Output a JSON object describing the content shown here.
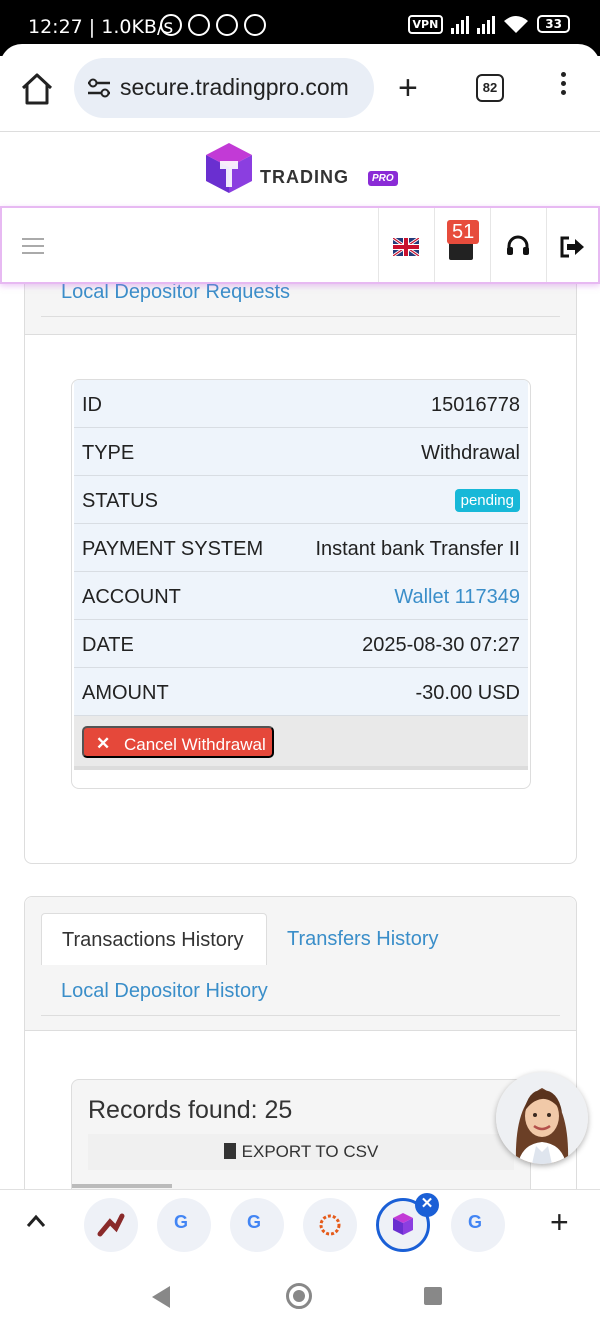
{
  "status_bar": {
    "time": "12:27 | 1.0KB/s",
    "vpn": "VPN",
    "battery": "33"
  },
  "browser": {
    "url": "secure.tradingpro.com",
    "tab_count": "82"
  },
  "brand": {
    "name": "TRADING",
    "tag": "PRO"
  },
  "navbar": {
    "messages_badge": "51"
  },
  "request_panel": {
    "header_link": "Local Depositor Requests",
    "rows": [
      {
        "key": "ID",
        "value": "15016778"
      },
      {
        "key": "TYPE",
        "value": "Withdrawal"
      },
      {
        "key": "STATUS",
        "value": "pending"
      },
      {
        "key": "PAYMENT SYSTEM",
        "value": "Instant bank Transfer II"
      },
      {
        "key": "ACCOUNT",
        "value": "Wallet 117349"
      },
      {
        "key": "DATE",
        "value": "2025-08-30 07:27"
      },
      {
        "key": "AMOUNT",
        "value": "-30.00 USD"
      }
    ],
    "cancel_label": "Cancel Withdrawal"
  },
  "history_panel": {
    "tabs": [
      "Transactions History",
      "Transfers History",
      "Local Depositor History"
    ],
    "records_found": "Records found: 25",
    "export_label": "EXPORT TO CSV"
  },
  "colors": {
    "link": "#3a8ec9",
    "pending": "#17b8d8",
    "danger": "#e5483a",
    "brand_purple": "#8a2bd6",
    "chrome_blue": "#1a5fd6"
  }
}
